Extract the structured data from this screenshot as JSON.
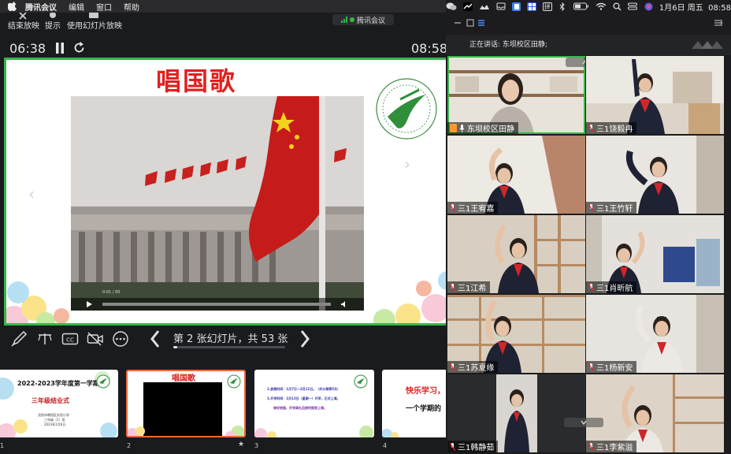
{
  "menubar": {
    "app_name": "腾讯会议",
    "items": [
      "编辑",
      "窗口",
      "帮助"
    ],
    "right_icons": [
      "wechat-icon",
      "bird-icon",
      "cloud-icon",
      "tray-icon",
      "doc-icon",
      "grid-icon",
      "pinyin-icon",
      "bluetooth-icon",
      "battery-icon",
      "wifi-icon",
      "search-icon",
      "control-center-icon",
      "siri-icon"
    ],
    "pinyin_label": "拼",
    "datetime": "1月6日 周五  08:58"
  },
  "toolbar": {
    "end_show": "结束放映",
    "hint": "提示",
    "use_slideshow": "使用幻灯片放映",
    "meeting_label": "腾讯会议"
  },
  "presenter": {
    "elapsed": "06:38",
    "clock": "08:58",
    "slide_counter": "第 2 张幻灯片，共 53 张",
    "progress": 0.0377
  },
  "slide": {
    "title": "唱国歌",
    "video_time": "0:01 / 00"
  },
  "thumbnails": [
    {
      "num": "1",
      "line1": "2022-2023学年度第一学期",
      "line2": "三年级结业式",
      "line3": "沈阳市朝阳区实验小学",
      "line4": "三年级（1）班",
      "line5": "2023年1月6日"
    },
    {
      "num": "2",
      "title": "唱国歌"
    },
    {
      "num": "3",
      "line1": "1.放假时间：1月7日—2月12日。（共计周等5天）",
      "line2": "2.开学时间：2月13日（星期一）开学，正式上课。",
      "line3": "穿好校服，开学典礼后按时报到上课。"
    },
    {
      "num": "4",
      "line1": "快乐学习，",
      "line2": "一个学期的"
    }
  ],
  "participants_panel": {
    "speaking": "正在讲话: 东坝校区田静;",
    "tiles": [
      {
        "name": "东坝校区田静"
      },
      {
        "name": "三1饶毅冉"
      },
      {
        "name": "三1王宥嘉"
      },
      {
        "name": "三1王竹轩"
      },
      {
        "name": "三1江希"
      },
      {
        "name": "三1肖昕航"
      },
      {
        "name": "三1苏夏缘"
      },
      {
        "name": "三1杨新安"
      },
      {
        "name": "三1韩静茹"
      },
      {
        "name": "三1李紫溢"
      }
    ]
  },
  "colors": {
    "accent_green": "#39b54a",
    "title_red": "#e02020",
    "selected_thumb": "#e8683d"
  }
}
